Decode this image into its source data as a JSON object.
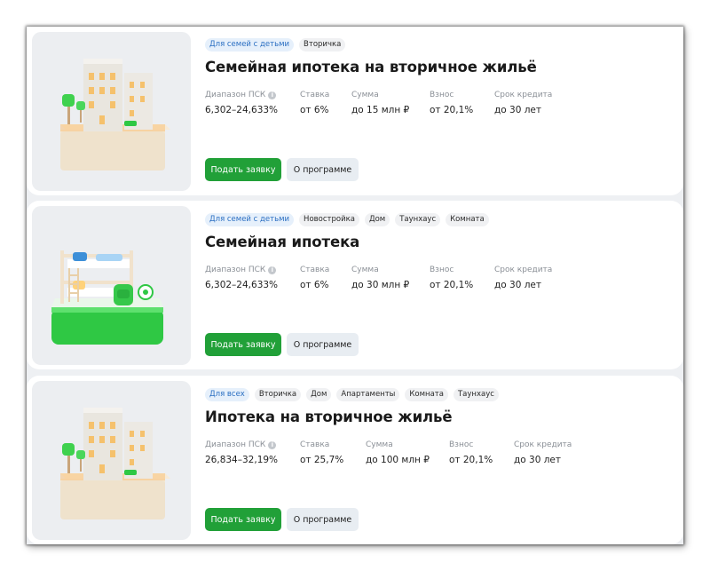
{
  "cards": [
    {
      "tags": [
        "Для семей с детьми",
        "Вторичка"
      ],
      "title": "Семейная ипотека на вторичное жильё",
      "params": [
        {
          "label": "Диапазон ПСК",
          "value": "6,302–24,633%",
          "info": true
        },
        {
          "label": "Ставка",
          "value": "от 6%"
        },
        {
          "label": "Сумма",
          "value": "до 15 млн ₽"
        },
        {
          "label": "Взнос",
          "value": "от 20,1%"
        },
        {
          "label": "Срок кредита",
          "value": "до 30 лет"
        }
      ],
      "apply_label": "Подать заявку",
      "about_label": "О программе",
      "image": "building-illustration"
    },
    {
      "tags": [
        "Для семей с детьми",
        "Новостройка",
        "Дом",
        "Таунхаус",
        "Комната"
      ],
      "title": "Семейная ипотека",
      "params": [
        {
          "label": "Диапазон ПСК",
          "value": "6,302–24,633%",
          "info": true
        },
        {
          "label": "Ставка",
          "value": "от 6%"
        },
        {
          "label": "Сумма",
          "value": "до 30 млн ₽"
        },
        {
          "label": "Взнос",
          "value": "от 20,1%"
        },
        {
          "label": "Срок кредита",
          "value": "до 30 лет"
        }
      ],
      "apply_label": "Подать заявку",
      "about_label": "О программе",
      "image": "bunk-bed-illustration"
    },
    {
      "tags": [
        "Для всех",
        "Вторичка",
        "Дом",
        "Апартаменты",
        "Комната",
        "Таунхаус"
      ],
      "title": "Ипотека на вторичное жильё",
      "params": [
        {
          "label": "Диапазон ПСК",
          "value": "26,834–32,19%",
          "info": true
        },
        {
          "label": "Ставка",
          "value": "от 25,7%"
        },
        {
          "label": "Сумма",
          "value": "до 100 млн ₽"
        },
        {
          "label": "Взнос",
          "value": "от 20,1%"
        },
        {
          "label": "Срок кредита",
          "value": "до 30 лет"
        }
      ],
      "apply_label": "Подать заявку",
      "about_label": "О программе",
      "image": "building-illustration"
    }
  ],
  "colors": {
    "primary_green": "#21a038",
    "tag_primary_text": "#2b6fc2",
    "tag_primary_bg": "#e6f0fb"
  }
}
